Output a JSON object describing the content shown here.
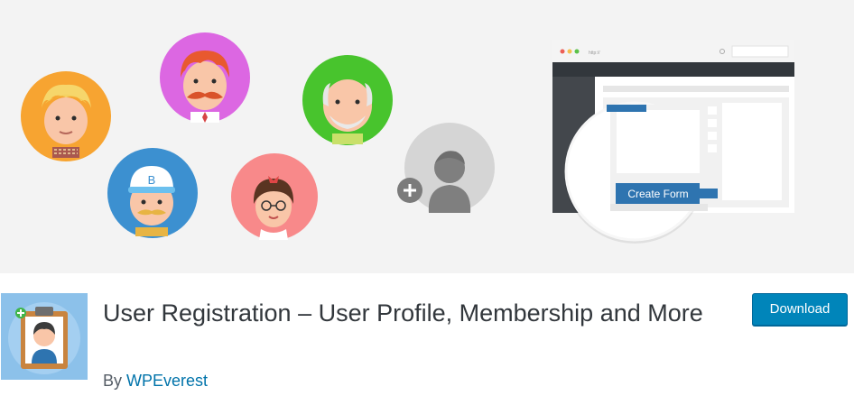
{
  "banner": {
    "mockup": {
      "url_text": "http://",
      "create_form_label": "Create Form"
    }
  },
  "plugin": {
    "title": "User Registration – User Profile, Membership and More",
    "author_prefix": "By",
    "author_name": "WPEverest",
    "download_label": "Download"
  },
  "colors": {
    "banner_bg": "#f3f3f3",
    "accent_blue": "#2e74b0",
    "download_button": "#0085ba",
    "author_link": "#0073aa",
    "title_text": "#32373c"
  }
}
